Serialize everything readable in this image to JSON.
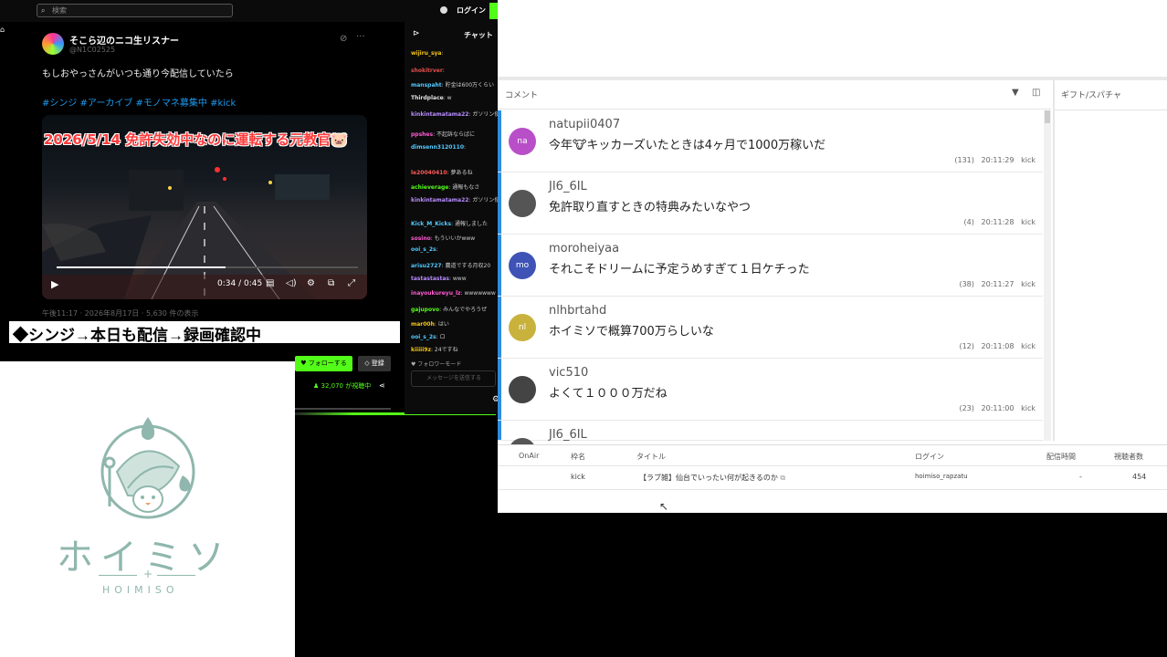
{
  "topbar": {
    "search_placeholder": "検索",
    "login_label": "ログイン"
  },
  "tweet": {
    "author_name": "そこら辺のニコ生リスナー",
    "author_handle": "@N1C02525",
    "text": "もしおやっさんがいつも通り今配信していたら",
    "hashtags": "#シンジ #アーカイブ #モノマネ募集中 #kick",
    "video_caption": "2026/5/14 免許失効中なのに運転する元教官🐷",
    "video_time": "0:34 / 0:45",
    "video_progress": 0.56,
    "meta": "午後11:17 · 2026年8月17日 · 5,630 件の表示"
  },
  "banner": {
    "text": "◆シンジ→本日も配信→録画確認中"
  },
  "stream_bar": {
    "follow_label": "♥ フォローする",
    "register_label": "◇ 登録",
    "viewers": "32,070 が視聴中"
  },
  "kick_chat": {
    "title": "チャット",
    "messages": [
      {
        "user": "wijiru_sya",
        "text": "",
        "color": "#f5c518"
      },
      {
        "user": "shokitrver",
        "text": "",
        "color": "#e64e4e"
      },
      {
        "user": "manspaht",
        "text": "貯金は600万くらい",
        "color": "#53c9ff"
      },
      {
        "user": "Thirdplace",
        "text": "w",
        "color": "#e3e3e3"
      },
      {
        "user": "kinkintamatama22",
        "text": "ガソリン使っちゃダメされるわ",
        "color": "#b88cff"
      },
      {
        "user": "ppshes",
        "text": "不起訴ならばに",
        "color": "#ff5ad1"
      },
      {
        "user": "dimsenn3120110",
        "text": "",
        "color": "#53c9ff"
      },
      {
        "user": "le20040410",
        "text": "夢あるね",
        "color": "#ff5a5a"
      },
      {
        "user": "achieverage",
        "text": "通報もなさ",
        "color": "#53fc18"
      },
      {
        "user": "kinkintamatama22",
        "text": "ガソリン使っちゃダメされるわ",
        "color": "#b88cff"
      },
      {
        "user": "Kick_M_Kicks",
        "text": "通報しました",
        "color": "#53c9ff"
      },
      {
        "user": "sosino",
        "text": "もういいかwww",
        "color": "#ff5ad1"
      },
      {
        "user": "ooi_s_2s",
        "text": "",
        "color": "#53c9ff"
      },
      {
        "user": "arisu2727",
        "text": "農道でする月収20",
        "color": "#53c9ff"
      },
      {
        "user": "tastastastas",
        "text": "www",
        "color": "#b88cff"
      },
      {
        "user": "inayoukureyu_lz",
        "text": "wwwwwww",
        "color": "#ff5ad1"
      },
      {
        "user": "gajupovo",
        "text": "みんなでやろうぜ",
        "color": "#53fc18"
      },
      {
        "user": "mar00h",
        "text": "はい",
        "color": "#f5c518"
      },
      {
        "user": "ooi_s_2s",
        "text": "ロ",
        "color": "#53c9ff"
      },
      {
        "user": "kiiiii9z",
        "text": "24ですね",
        "color": "#f5c518"
      }
    ],
    "follow_note": "♥ フォロワーモード",
    "input_placeholder": "メッセージを送信する"
  },
  "logo": {
    "title": "ホイミソ",
    "subtitle": "HOIMISO",
    "color": "#8fb7ad"
  },
  "comment_panel": {
    "header": "コメント",
    "gift_header": "ギフト/スパチャ",
    "comments": [
      {
        "name": "natupii0407",
        "text": "今年🐮キッカーズいたときは4ヶ月で1000万稼いだ",
        "count": "(131)",
        "time": "20:11:29",
        "platform": "kick",
        "avatar_label": "na",
        "avatar_color": "#b94fc8"
      },
      {
        "name": "JI6_6IL",
        "text": "免許取り直すときの特典みたいなやつ",
        "count": "(4)",
        "time": "20:11:28",
        "platform": "kick",
        "avatar_label": "",
        "avatar_color": "#555555"
      },
      {
        "name": "moroheiyaa",
        "text": "それこそドリームに予定うめすぎて１日ケチった",
        "count": "(38)",
        "time": "20:11:27",
        "platform": "kick",
        "avatar_label": "mo",
        "avatar_color": "#3e53b5"
      },
      {
        "name": "nlhbrtahd",
        "text": "ホイミソで概算700万らしいな",
        "count": "(12)",
        "time": "20:11:08",
        "platform": "kick",
        "avatar_label": "nl",
        "avatar_color": "#c9b23c"
      },
      {
        "name": "vic510",
        "text": "よくて１０００万だね",
        "count": "(23)",
        "time": "20:11:00",
        "platform": "kick",
        "avatar_label": "",
        "avatar_color": "#444444"
      },
      {
        "name": "JI6_6IL",
        "text": "",
        "count": "",
        "time": "",
        "platform": "",
        "avatar_label": "",
        "avatar_color": "#555555"
      }
    ]
  },
  "broadcast_table": {
    "headers": [
      "OnAir",
      "枠名",
      "タイトル",
      "ログイン",
      "配信時間",
      "視聴者数"
    ],
    "row": {
      "onair": "",
      "frame": "kick",
      "title": "【ラブ雑】仙台でいったい何が起きるのか",
      "login": "hoimiso_rapzatu",
      "duration": "-",
      "viewers": "454"
    }
  }
}
